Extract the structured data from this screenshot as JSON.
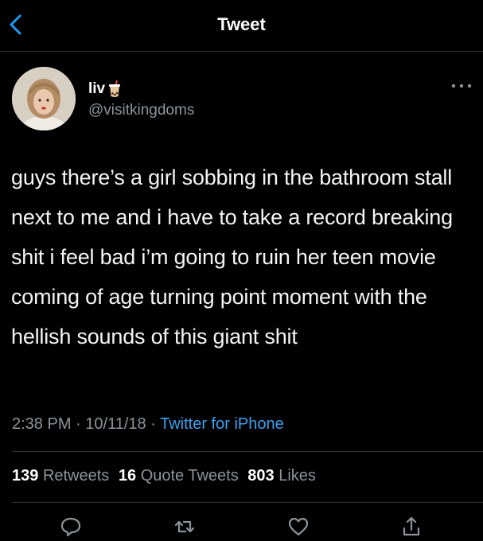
{
  "header": {
    "title": "Tweet",
    "back_icon": "chevron-left-icon",
    "accent_color": "#1d9bf0"
  },
  "author": {
    "display_name": "liv",
    "name_emoji_icon": "bubble-tea-icon",
    "handle": "@visitkingdoms"
  },
  "tweet": {
    "text": "guys there’s a girl sobbing in the bathroom stall next to me and i have to take a record breaking shit i feel bad i’m going to ruin her teen movie coming of age turning point moment with the hellish sounds of this giant shit",
    "time": "2:38 PM",
    "separator": "·",
    "date": "10/11/18",
    "source": "Twitter for iPhone"
  },
  "stats": {
    "retweets_count": "139",
    "retweets_label": "Retweets",
    "quote_count": "16",
    "quote_label": "Quote Tweets",
    "likes_count": "803",
    "likes_label": "Likes"
  },
  "actions": [
    "reply-icon",
    "retweet-icon",
    "like-icon",
    "share-icon"
  ],
  "colors": {
    "background": "#000000",
    "text_primary": "#e7e9ea",
    "text_secondary": "#8b949b",
    "link": "#3aa2f0",
    "divider": "#2f3336"
  }
}
